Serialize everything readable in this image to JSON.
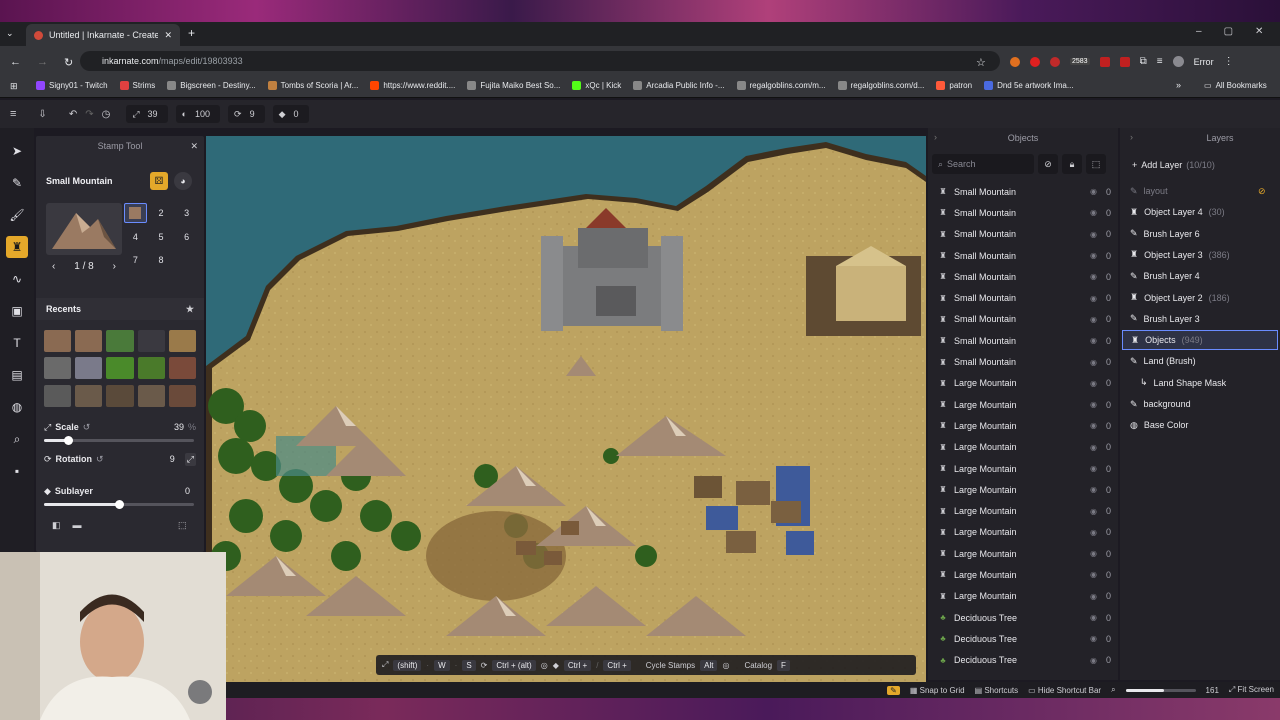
{
  "browser": {
    "tab_title": "Untitled | Inkarnate - Create Fa",
    "url_host": "inkarnate.com",
    "url_path": "/maps/edit/19803933",
    "extension_badge": "2583",
    "error_label": "Error",
    "bookmarks": [
      {
        "label": "Signy01 - Twitch",
        "color": "#9146ff"
      },
      {
        "label": "Strims",
        "color": "#e04040"
      },
      {
        "label": "Bigscreen - Destiny...",
        "color": "#888888"
      },
      {
        "label": "Tombs of Scoria | Ar...",
        "color": "#c08040"
      },
      {
        "label": "https://www.reddit....",
        "color": "#ff4500"
      },
      {
        "label": "Fujita Maiko Best So...",
        "color": "#888888"
      },
      {
        "label": "xQc | Kick",
        "color": "#53fc18"
      },
      {
        "label": "Arcadia Public Info -...",
        "color": "#888888"
      },
      {
        "label": "regalgoblins.com/m...",
        "color": "#888888"
      },
      {
        "label": "regalgoblins.com/d...",
        "color": "#888888"
      },
      {
        "label": "patron",
        "color": "#ff5a3a"
      },
      {
        "label": "Dnd 5e artwork Ima...",
        "color": "#4a6adf"
      }
    ],
    "all_bookmarks": "All Bookmarks"
  },
  "toolbar": {
    "scale_value": "39",
    "opacity_value": "100",
    "rotation_value": "9",
    "layer_value": "0"
  },
  "stamp_tool": {
    "title": "Stamp Tool",
    "stamp_name": "Small Mountain",
    "pager": "1 / 8",
    "variants": [
      "1",
      "2",
      "3",
      "4",
      "5",
      "6",
      "7",
      "8"
    ],
    "recents_label": "Recents",
    "scale_label": "Scale",
    "scale_value": "39",
    "scale_unit": "%",
    "scale_fraction": 0.16,
    "rotation_label": "Rotation",
    "rotation_value": "9",
    "sublayer_label": "Sublayer",
    "sublayer_value": "0",
    "sublayer_fraction": 0.5
  },
  "objects_panel": {
    "title": "Objects",
    "search_placeholder": "Search",
    "items": [
      {
        "label": "Small Mountain",
        "z": "0",
        "icon": "stamp-icon"
      },
      {
        "label": "Small Mountain",
        "z": "0",
        "icon": "stamp-icon"
      },
      {
        "label": "Small Mountain",
        "z": "0",
        "icon": "stamp-icon"
      },
      {
        "label": "Small Mountain",
        "z": "0",
        "icon": "stamp-icon"
      },
      {
        "label": "Small Mountain",
        "z": "0",
        "icon": "stamp-icon"
      },
      {
        "label": "Small Mountain",
        "z": "0",
        "icon": "stamp-icon"
      },
      {
        "label": "Small Mountain",
        "z": "0",
        "icon": "stamp-icon"
      },
      {
        "label": "Small Mountain",
        "z": "0",
        "icon": "stamp-icon"
      },
      {
        "label": "Small Mountain",
        "z": "0",
        "icon": "stamp-icon"
      },
      {
        "label": "Large Mountain",
        "z": "0",
        "icon": "stamp-icon"
      },
      {
        "label": "Large Mountain",
        "z": "0",
        "icon": "stamp-icon"
      },
      {
        "label": "Large Mountain",
        "z": "0",
        "icon": "stamp-icon"
      },
      {
        "label": "Large Mountain",
        "z": "0",
        "icon": "stamp-icon"
      },
      {
        "label": "Large Mountain",
        "z": "0",
        "icon": "stamp-icon"
      },
      {
        "label": "Large Mountain",
        "z": "0",
        "icon": "stamp-icon"
      },
      {
        "label": "Large Mountain",
        "z": "0",
        "icon": "stamp-icon"
      },
      {
        "label": "Large Mountain",
        "z": "0",
        "icon": "stamp-icon"
      },
      {
        "label": "Large Mountain",
        "z": "0",
        "icon": "stamp-icon"
      },
      {
        "label": "Large Mountain",
        "z": "0",
        "icon": "stamp-icon"
      },
      {
        "label": "Large Mountain",
        "z": "0",
        "icon": "stamp-icon"
      },
      {
        "label": "Deciduous Tree",
        "z": "0",
        "icon": "tree-icon"
      },
      {
        "label": "Deciduous Tree",
        "z": "0",
        "icon": "tree-icon"
      },
      {
        "label": "Deciduous Tree",
        "z": "0",
        "icon": "tree-icon"
      }
    ]
  },
  "layers_panel": {
    "title": "Layers",
    "add_layer": "Add Layer",
    "add_layer_count": "(10/10)",
    "items": [
      {
        "label": "layout",
        "count": "",
        "type": "brush",
        "dim": true,
        "selected": false
      },
      {
        "label": "Object Layer 4",
        "count": "(30)",
        "type": "object",
        "dim": false,
        "selected": false
      },
      {
        "label": "Brush Layer 6",
        "count": "",
        "type": "brush",
        "dim": false,
        "selected": false
      },
      {
        "label": "Object Layer 3",
        "count": "(386)",
        "type": "object",
        "dim": false,
        "selected": false
      },
      {
        "label": "Brush Layer 4",
        "count": "",
        "type": "brush",
        "dim": false,
        "selected": false
      },
      {
        "label": "Object Layer 2",
        "count": "(186)",
        "type": "object",
        "dim": false,
        "selected": false
      },
      {
        "label": "Brush Layer 3",
        "count": "",
        "type": "brush",
        "dim": false,
        "selected": false
      },
      {
        "label": "Objects",
        "count": "(949)",
        "type": "object",
        "dim": false,
        "selected": true
      },
      {
        "label": "Land (Brush)",
        "count": "",
        "type": "brush",
        "dim": false,
        "selected": false
      },
      {
        "label": "Land Shape Mask",
        "count": "",
        "type": "mask",
        "dim": false,
        "selected": false
      },
      {
        "label": "background",
        "count": "",
        "type": "brush",
        "dim": false,
        "selected": false
      },
      {
        "label": "Base Color",
        "count": "",
        "type": "color",
        "dim": false,
        "selected": false
      }
    ]
  },
  "shortcut_bar": {
    "shift": "(shift)",
    "w": "W",
    "s": "S",
    "ctrl_alt": "Ctrl + (alt)",
    "ctrl_plus_1": "Ctrl +",
    "ctrl_plus_2": "Ctrl +",
    "cycle_stamps": "Cycle Stamps",
    "alt": "Alt",
    "catalog": "Catalog",
    "f": "F"
  },
  "status_bar": {
    "snap": "Snap to Grid",
    "shortcuts": "Shortcuts",
    "hide_shortcut": "Hide Shortcut Bar",
    "zoom_value": "161",
    "zoom_fraction": 0.55,
    "fit_screen": "Fit Screen"
  },
  "colors": {
    "accent": "#e4a82a",
    "selection": "#6a8cff",
    "land": "#bfa462",
    "water": "#2f6a78"
  }
}
